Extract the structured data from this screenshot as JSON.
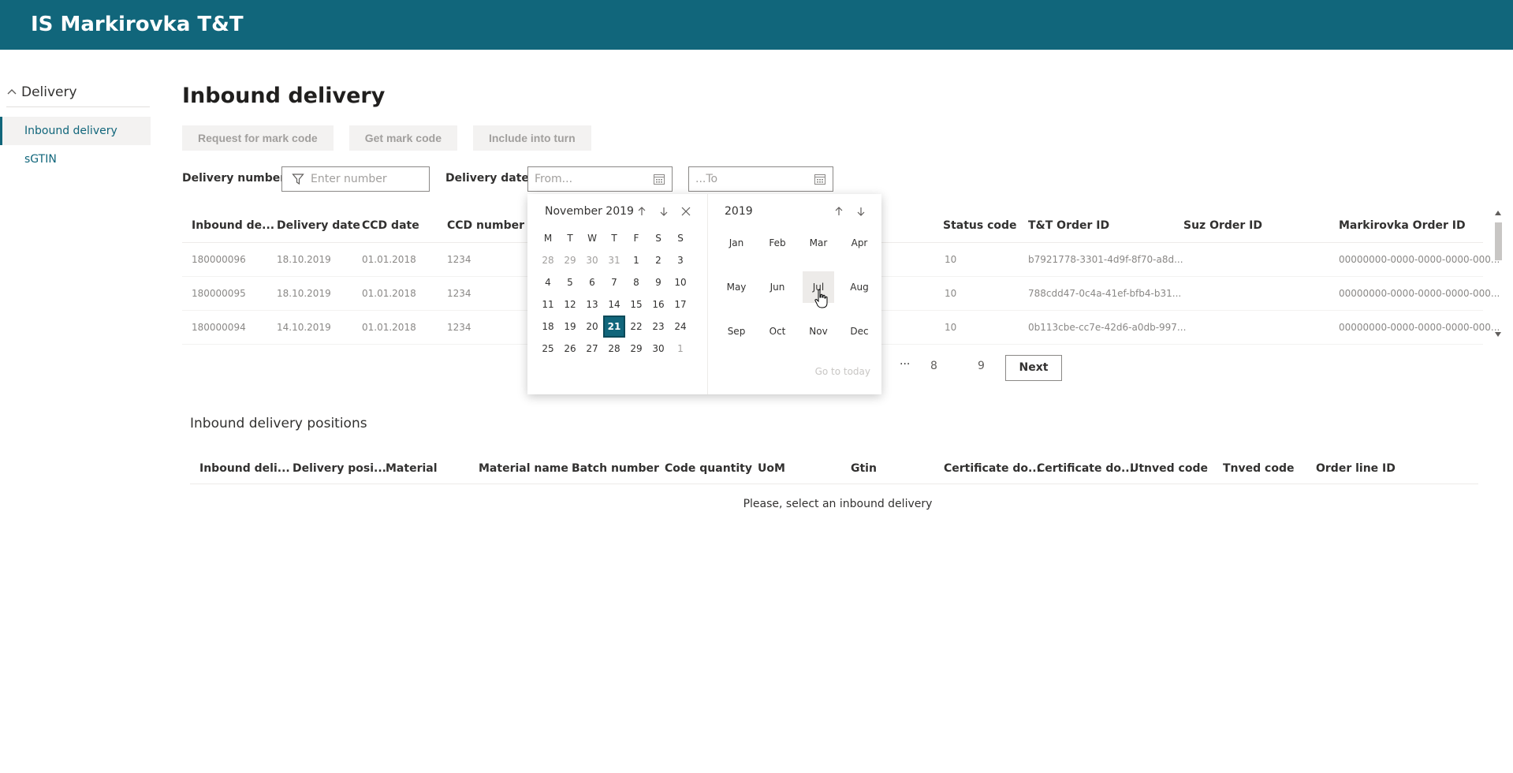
{
  "app": {
    "title": "IS Markirovka T&T"
  },
  "sidebar": {
    "group": "Delivery",
    "items": [
      {
        "label": "Inbound delivery",
        "active": true
      },
      {
        "label": "sGTIN",
        "active": false
      }
    ]
  },
  "page": {
    "title": "Inbound delivery"
  },
  "toolbar": {
    "request_label": "Request for mark code",
    "get_label": "Get mark code",
    "include_label": "Include into turn"
  },
  "filters": {
    "delivery_number_label": "Delivery number",
    "delivery_number_placeholder": "Enter number",
    "delivery_date_label": "Delivery date",
    "from_placeholder": "From...",
    "to_placeholder": "...To"
  },
  "table": {
    "columns": [
      "Inbound de...",
      "Delivery date",
      "CCD date",
      "CCD number",
      "Status code",
      "T&T Order ID",
      "Suz Order ID",
      "Markirovka Order ID"
    ],
    "rows": [
      [
        "180000096",
        "18.10.2019",
        "01.01.2018",
        "1234",
        "10",
        "b7921778-3301-4d9f-8f70-a8d...",
        "",
        "00000000-0000-0000-0000-000..."
      ],
      [
        "180000095",
        "18.10.2019",
        "01.01.2018",
        "1234",
        "10",
        "788cdd47-0c4a-41ef-bfb4-b31...",
        "",
        "00000000-0000-0000-0000-000..."
      ],
      [
        "180000094",
        "14.10.2019",
        "01.01.2018",
        "1234",
        "10",
        "0b113cbe-cc7e-42d6-a0db-997...",
        "",
        "00000000-0000-0000-0000-000..."
      ]
    ]
  },
  "pagination": {
    "ellipsis": "···",
    "pages": [
      "8",
      "9"
    ],
    "next_label": "Next"
  },
  "positions": {
    "title": "Inbound delivery positions",
    "columns": [
      "Inbound deli...",
      "Delivery posi...",
      "Material",
      "Material name",
      "Batch number",
      "Code quantity",
      "UoM",
      "Gtin",
      "Certificate do...",
      "Certificate do...",
      "Utnved code",
      "Tnved code",
      "Order line ID"
    ],
    "empty_message": "Please, select an inbound delivery"
  },
  "calendar": {
    "month_label": "November 2019",
    "weekdays": [
      "M",
      "T",
      "W",
      "T",
      "F",
      "S",
      "S"
    ],
    "weeks": [
      [
        "28",
        "29",
        "30",
        "31",
        "1",
        "2",
        "3"
      ],
      [
        "4",
        "5",
        "6",
        "7",
        "8",
        "9",
        "10"
      ],
      [
        "11",
        "12",
        "13",
        "14",
        "15",
        "16",
        "17"
      ],
      [
        "18",
        "19",
        "20",
        "21",
        "22",
        "23",
        "24"
      ],
      [
        "25",
        "26",
        "27",
        "28",
        "29",
        "30",
        "1"
      ]
    ],
    "selected_day": "21",
    "year_label": "2019",
    "months": [
      "Jan",
      "Feb",
      "Mar",
      "Apr",
      "May",
      "Jun",
      "Jul",
      "Aug",
      "Sep",
      "Oct",
      "Nov",
      "Dec"
    ],
    "hover_month": "Jul",
    "go_to_today": "Go to today"
  },
  "colors": {
    "brand": "#11667b",
    "disabled_bg": "#f3f2f1",
    "disabled_text": "#a19f9d"
  }
}
